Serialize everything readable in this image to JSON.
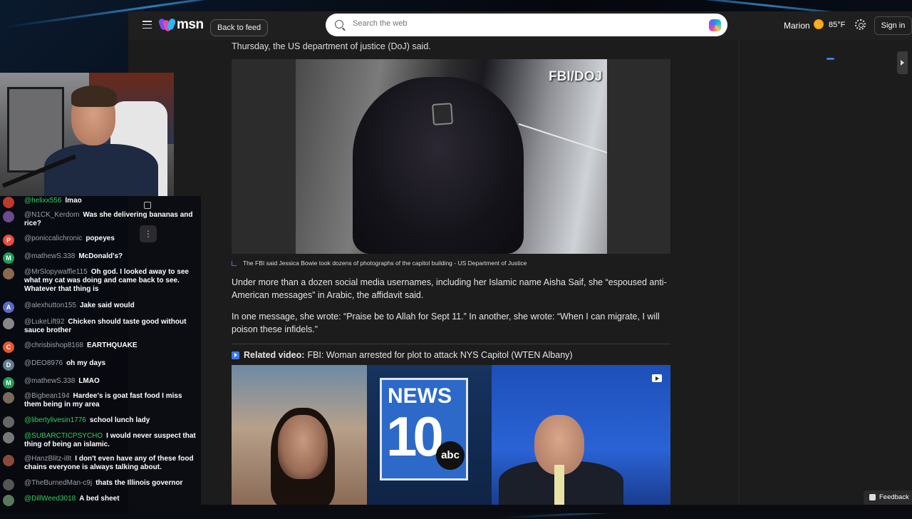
{
  "header": {
    "logo_text": "msn",
    "back_label": "Back to feed",
    "search_placeholder": "Search the web",
    "user_name": "Marion",
    "temperature": "85°F",
    "signin_label": "Sign in"
  },
  "article": {
    "top_line": "Thursday, the US department of justice (DoJ) said.",
    "photo_watermark": "FBI/DOJ",
    "caption": "The FBI said Jessica Bowie took dozens of photographs of the capitol building - US Department of Justice",
    "para1": "Under more than a dozen social media usernames, including her Islamic name Aisha Saif, she “espoused anti-American messages” in Arabic, the affidavit said.",
    "para2": "In one message, she wrote: “Praise be to Allah for Sept 11.” In another, she wrote: “When I can migrate, I will poison these infidels.”",
    "related_label": "Related video:",
    "related_title": "FBI: Woman arrested for plot to attack NYS Capitol (WTEN Albany)",
    "video_logo_news": "NEWS",
    "video_logo_ten": "10",
    "video_logo_abc": "abc"
  },
  "chat": {
    "messages": [
      {
        "user": "@helixx556",
        "text": "lmao",
        "avatar": "",
        "color": "#c0392b"
      },
      {
        "user": "@N1CK_Kerdom",
        "text": "Was she delivering bananas and rice?",
        "avatar": "",
        "color": "#6b4b8a"
      },
      {
        "user": "@poniccalichronic",
        "text": "popeyes",
        "avatar": "P",
        "color": "#e74c3c"
      },
      {
        "user": "@mathewS.338",
        "text": "McDonald's?",
        "avatar": "M",
        "color": "#1e9e57"
      },
      {
        "user": "@MrSlopywaffle115",
        "text": "Oh god. I looked away to see what my cat was doing and came back to see. Whatever that thing is",
        "avatar": "",
        "color": "#8a6a4a"
      },
      {
        "user": "@alexhutton155",
        "text": "Jake said would",
        "avatar": "A",
        "color": "#5c6bc0"
      },
      {
        "user": "@LukeLift92",
        "text": "Chicken should taste good without sauce brother",
        "avatar": "",
        "color": "#888"
      },
      {
        "user": "@chrisbishop8168",
        "text": "EARTHQUAKE",
        "avatar": "C",
        "color": "#e4572e"
      },
      {
        "user": "@DEO8976",
        "text": "oh my days",
        "avatar": "D",
        "color": "#607d8b"
      },
      {
        "user": "@mathewS.338",
        "text": "LMAO",
        "avatar": "M",
        "color": "#1e9e57"
      },
      {
        "user": "@Bigbean194",
        "text": "Hardee's is goat fast food I miss them being in my area",
        "avatar": "",
        "color": "#7a6a5a"
      },
      {
        "user": "@libertylivesin1776",
        "text": "school lunch lady",
        "avatar": "",
        "color": "#666"
      },
      {
        "user": "@SUBARCTICPSYCHO",
        "text": "I would never suspect that thing of being an islamic.",
        "avatar": "",
        "color": "#777"
      },
      {
        "user": "@HanzBlitz-i8t",
        "text": "I don't even have any of these food chains everyone is always talking about.",
        "avatar": "",
        "color": "#8a4a3a"
      },
      {
        "user": "@TheBurnedMan-c9j",
        "text": "thats the Illinois governor",
        "avatar": "",
        "color": "#555"
      },
      {
        "user": "@DillWeed3018",
        "text": "A bed sheet",
        "avatar": "",
        "color": "#5a7a5a"
      }
    ]
  },
  "feedback_label": "Feedback"
}
